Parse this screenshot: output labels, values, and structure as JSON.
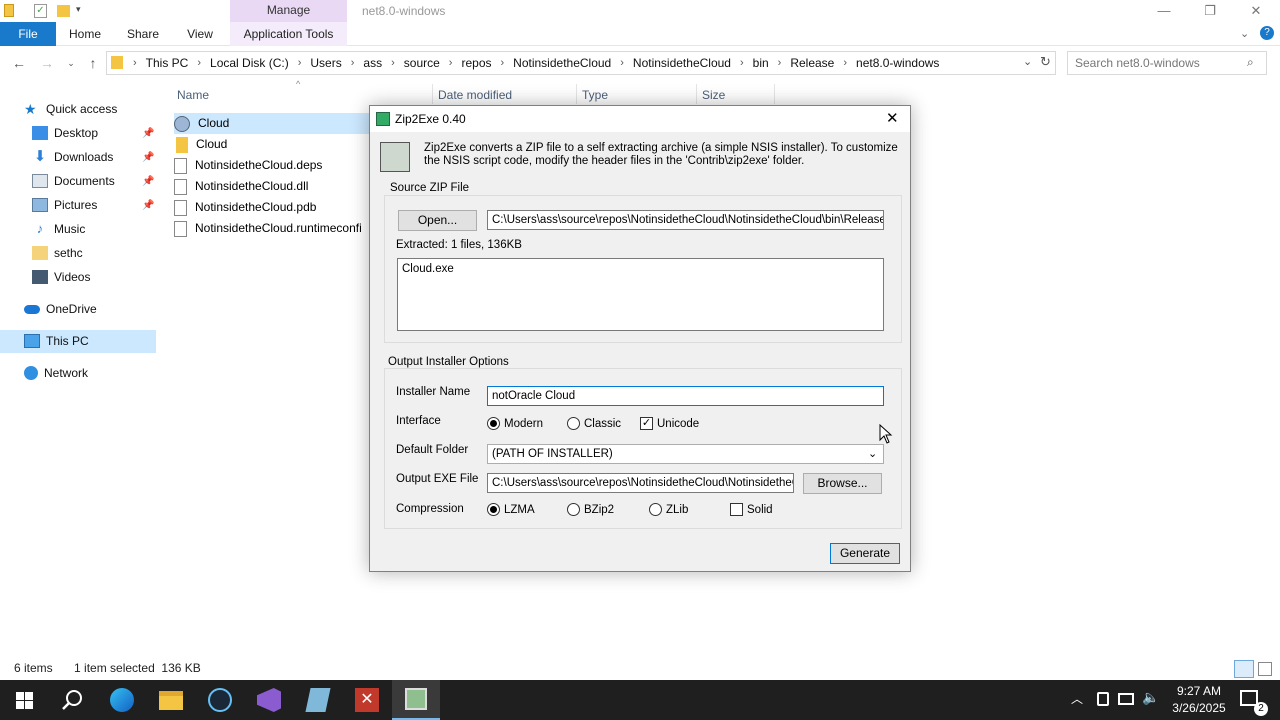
{
  "window": {
    "title": "net8.0-windows",
    "context_tab": "Manage",
    "controls": {
      "minimize": "—",
      "restore": "❐",
      "close": "✕"
    }
  },
  "ribbon": {
    "tabs": [
      "File",
      "Home",
      "Share",
      "View",
      "Application Tools"
    ]
  },
  "address": {
    "crumbs": [
      "This PC",
      "Local Disk (C:)",
      "Users",
      "ass",
      "source",
      "repos",
      "NotinsidetheCloud",
      "NotinsidetheCloud",
      "bin",
      "Release",
      "net8.0-windows"
    ],
    "search_placeholder": "Search net8.0-windows"
  },
  "nav": {
    "quick_access": "Quick access",
    "items": [
      "Desktop",
      "Downloads",
      "Documents",
      "Pictures",
      "Music",
      "sethc",
      "Videos"
    ],
    "onedrive": "OneDrive",
    "this_pc": "This PC",
    "network": "Network"
  },
  "files": {
    "columns": [
      "Name",
      "Date modified",
      "Type",
      "Size"
    ],
    "rows": [
      "Cloud",
      "Cloud",
      "NotinsidetheCloud.deps",
      "NotinsidetheCloud.dll",
      "NotinsidetheCloud.pdb",
      "NotinsidetheCloud.runtimeconfi"
    ]
  },
  "status": {
    "items": "6 items",
    "selected": "1 item selected  136 KB"
  },
  "dialog": {
    "title": "Zip2Exe 0.40",
    "description": "Zip2Exe converts a ZIP file to a self extracting archive (a simple NSIS installer). To customize the NSIS script code, modify the header files in the 'Contrib\\zip2exe' folder.",
    "source_group": "Source ZIP File",
    "open_button": "Open...",
    "zip_path": "C:\\Users\\ass\\source\\repos\\NotinsidetheCloud\\NotinsidetheCloud\\bin\\Release\\ne",
    "extracted": "Extracted: 1 files, 136KB",
    "file_list": "Cloud.exe",
    "output_group": "Output Installer Options",
    "installer_name_label": "Installer Name",
    "installer_name_value": "notOracle Cloud",
    "interface_label": "Interface",
    "interface_modern": "Modern",
    "interface_classic": "Classic",
    "unicode": "Unicode",
    "default_folder_label": "Default Folder",
    "default_folder_value": "(PATH OF INSTALLER)",
    "output_exe_label": "Output EXE File",
    "output_exe_value": "C:\\Users\\ass\\source\\repos\\NotinsidetheCloud\\NotinsidetheClo",
    "browse_button": "Browse...",
    "compression_label": "Compression",
    "lzma": "LZMA",
    "bzip2": "BZip2",
    "zlib": "ZLib",
    "solid": "Solid",
    "generate_button": "Generate"
  },
  "taskbar": {
    "time": "9:27 AM",
    "date": "3/26/2025",
    "notification_count": "2"
  },
  "colors": {
    "file_tab": "#1979ca",
    "selection": "#cce8ff",
    "context_tab": "#e9d9f4",
    "taskbar": "#1f1f1f"
  }
}
